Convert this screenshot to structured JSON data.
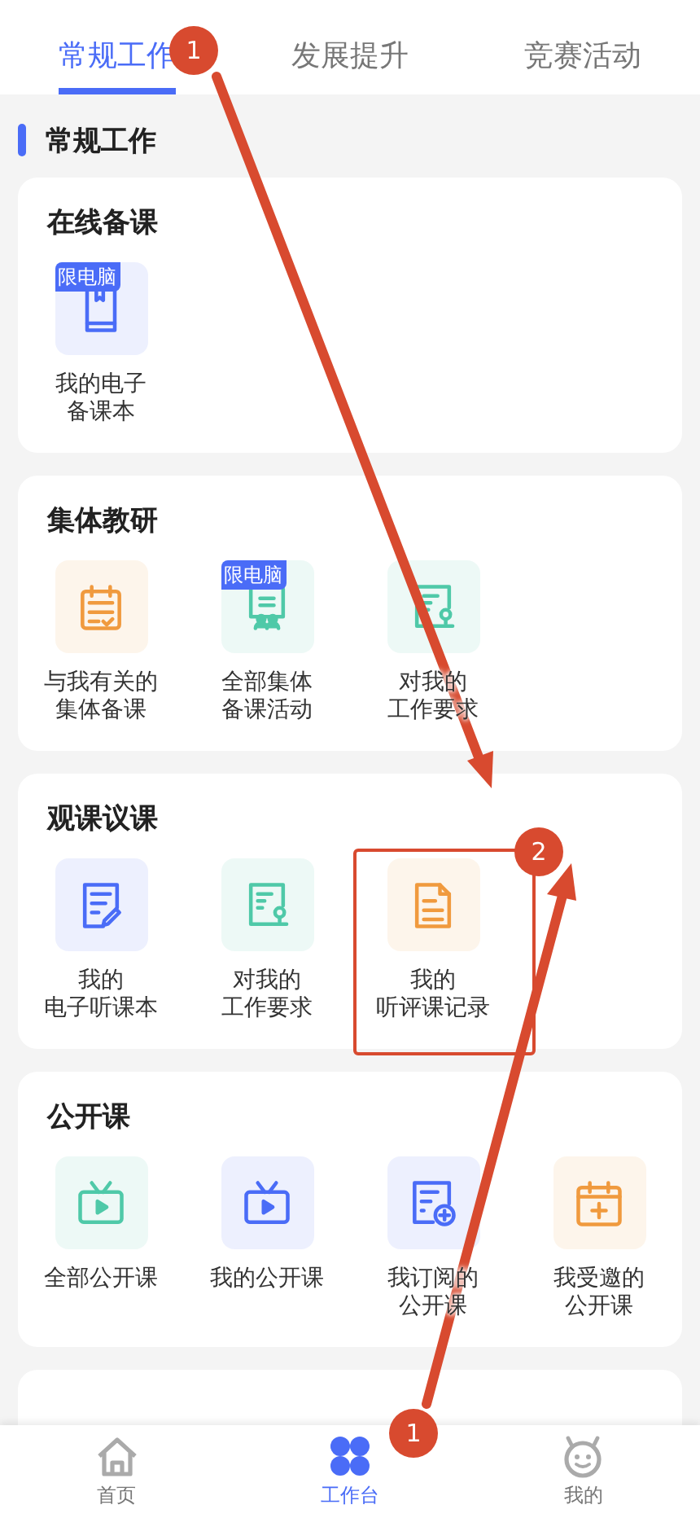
{
  "tabs": [
    {
      "label": "常规工作",
      "selected": true
    },
    {
      "label": "发展提升",
      "selected": false
    },
    {
      "label": "竞赛活动",
      "selected": false
    }
  ],
  "section_title": "常规工作",
  "cards": [
    {
      "title": "在线备课",
      "items": [
        {
          "lines": [
            "我的电子",
            "备课本"
          ],
          "kind": "book",
          "color": "#4a6cf7",
          "tag": "限电脑"
        }
      ]
    },
    {
      "title": "集体教研",
      "items": [
        {
          "lines": [
            "与我有关的",
            "集体备课"
          ],
          "kind": "calendar-check",
          "color": "#f09a3e"
        },
        {
          "lines": [
            "全部集体",
            "备课活动"
          ],
          "kind": "board-people",
          "color": "#4fc9a8",
          "tag": "限电脑"
        },
        {
          "lines": [
            "对我的",
            "工作要求"
          ],
          "kind": "doc-stamp",
          "color": "#4fc9a8"
        }
      ]
    },
    {
      "title": "观课议课",
      "items": [
        {
          "lines": [
            "我的",
            "电子听课本"
          ],
          "kind": "doc-edit",
          "color": "#4a6cf7"
        },
        {
          "lines": [
            "对我的",
            "工作要求"
          ],
          "kind": "doc-stamp",
          "color": "#4fc9a8"
        },
        {
          "lines": [
            "我的",
            "听评课记录"
          ],
          "kind": "doc",
          "color": "#f09a3e"
        }
      ]
    },
    {
      "title": "公开课",
      "items": [
        {
          "lines": [
            "全部公开课"
          ],
          "kind": "tv",
          "color": "#4fc9a8"
        },
        {
          "lines": [
            "我的公开课"
          ],
          "kind": "tv",
          "color": "#4a6cf7"
        },
        {
          "lines": [
            "我订阅的",
            "公开课"
          ],
          "kind": "doc-plus",
          "color": "#4a6cf7"
        },
        {
          "lines": [
            "我受邀的",
            "公开课"
          ],
          "kind": "calendar-plus",
          "color": "#f09a3e"
        }
      ]
    },
    {
      "kind": "blank"
    }
  ],
  "bottom_nav": [
    {
      "label": "首页",
      "kind": "home",
      "selected": false
    },
    {
      "label": "工作台",
      "kind": "clover",
      "selected": true
    },
    {
      "label": "我的",
      "kind": "face",
      "selected": false
    }
  ],
  "annotations": [
    {
      "kind": "marker",
      "label": "1"
    },
    {
      "kind": "arrow"
    },
    {
      "kind": "box"
    },
    {
      "kind": "marker",
      "label": "2"
    },
    {
      "kind": "arrow"
    },
    {
      "kind": "marker",
      "label": "1"
    }
  ]
}
